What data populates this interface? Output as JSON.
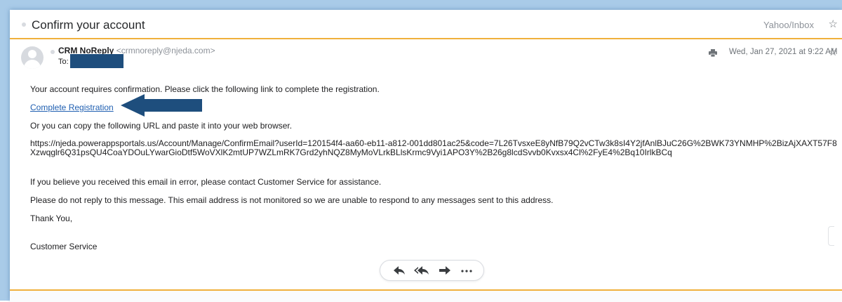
{
  "email": {
    "subject": "Confirm your account",
    "folder": "Yahoo/Inbox",
    "sender_name": "CRM NoReply",
    "sender_email": "<crmnoreply@njeda.com>",
    "to_label": "To:",
    "date": "Wed, Jan 27, 2021 at 9:22 AM",
    "body": {
      "line1": "Your account requires confirmation. Please click the following link to complete the registration.",
      "link_text": "Complete Registration",
      "line2": "Or you can copy the following URL and paste it into your web browser.",
      "url": "https://njeda.powerappsportals.us/Account/Manage/ConfirmEmail?userId=120154f4-aa60-eb11-a812-001dd801ac25&code=7L26TvsxeE8yNfB79Q2vCTw3k8sI4Y2jfAnlBJuC26G%2BWK73YNMHP%2BizAjXAXT57F8Xzwqglr6Q31psQU4CoaYDOuLYwarGioDtf5WoVXlK2mtUP7WZLmRK7Grd2yhNQZ8MyMoVLrkBLlsKrmc9Vyi1APO3Y%2B26g8lcdSvvb0Kvxsx4Cl%2FyE4%2Bq10IrlkBCq",
      "line3": "If you believe you received this email in error, please contact Customer Service for assistance.",
      "line4": "Please do not reply to this message. This email address is not monitored so we are unable to respond to any messages sent to this address.",
      "thanks": "Thank You,",
      "signature": "Customer Service"
    },
    "actions": [
      "reply-icon",
      "reply-all-icon",
      "forward-icon",
      "more-icon"
    ]
  },
  "colors": {
    "accent_border": "#f0b03c",
    "link": "#1f5fb1",
    "annotation_arrow": "#1e4e7d",
    "frame": "#a9cbe8"
  }
}
